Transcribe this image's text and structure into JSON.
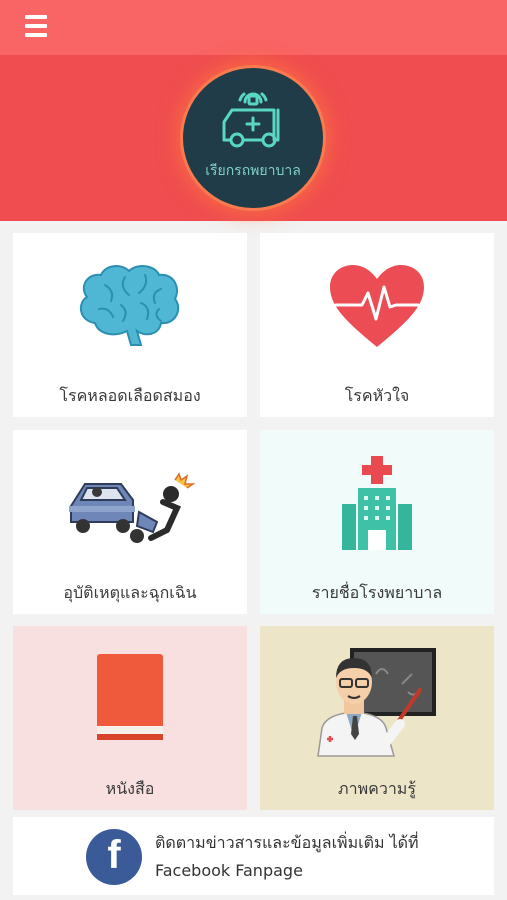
{
  "header": {
    "menu_icon": "hamburger-menu-icon",
    "color": "#f96464"
  },
  "hero": {
    "button_label": "เรียกรถพยาบาล",
    "button_icon": "ambulance-icon",
    "background": "#ef4d4f"
  },
  "cards": [
    {
      "label": "โรคหลอดเลือดสมอง",
      "icon": "brain-icon",
      "background": "#ffffff"
    },
    {
      "label": "โรคหัวใจ",
      "icon": "heart-pulse-icon",
      "background": "#ffffff"
    },
    {
      "label": "อุบัติเหตุและฉุกเฉิน",
      "icon": "car-accident-icon",
      "background": "#ffffff"
    },
    {
      "label": "รายชื่อโรงพยาบาล",
      "icon": "hospital-icon",
      "background": "#f0fbfa"
    },
    {
      "label": "หนังสือ",
      "icon": "book-icon",
      "background": "#f9e0e0"
    },
    {
      "label": "ภาพความรู้",
      "icon": "doctor-blackboard-icon",
      "background": "#ede5c8"
    }
  ],
  "facebook": {
    "line1": "ติดตามข่าวสารและข้อมูลเพิ่มเติม ได้ที่",
    "line2": "Facebook Fanpage",
    "icon_letter": "f",
    "color": "#3a5a98"
  }
}
